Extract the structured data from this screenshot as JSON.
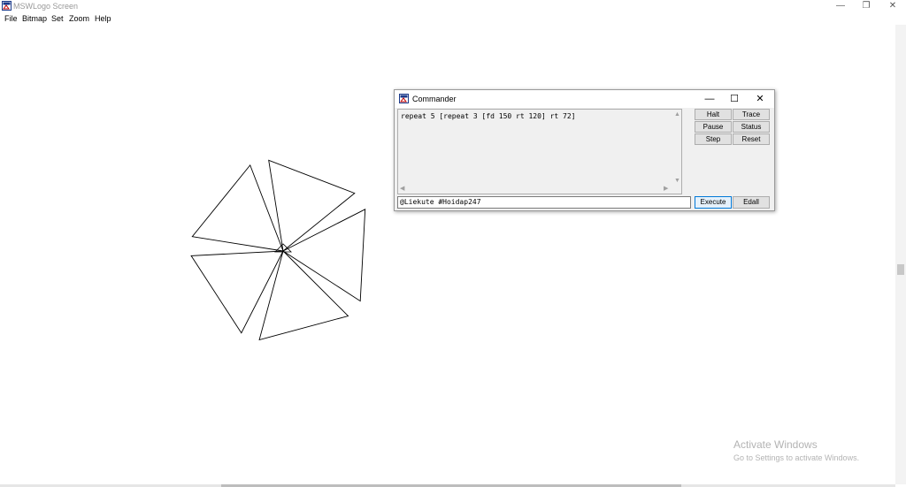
{
  "window": {
    "title": "MSWLogo Screen"
  },
  "menu": [
    "File",
    "Bitmap",
    "Set",
    "Zoom",
    "Help"
  ],
  "commander": {
    "title": "Commander",
    "history": "repeat 5 [repeat 3 [fd 150 rt 120] rt 72]",
    "input_value": "@Liekute #Hoidap247",
    "buttons": {
      "halt": "Halt",
      "trace": "Trace",
      "pause": "Pause",
      "status": "Status",
      "step": "Step",
      "reset": "Reset",
      "execute": "Execute",
      "edall": "Edall"
    }
  },
  "watermark": {
    "title": "Activate Windows",
    "subtitle": "Go to Settings to activate Windows."
  },
  "drawing": {
    "stroke_color": "#000000"
  }
}
